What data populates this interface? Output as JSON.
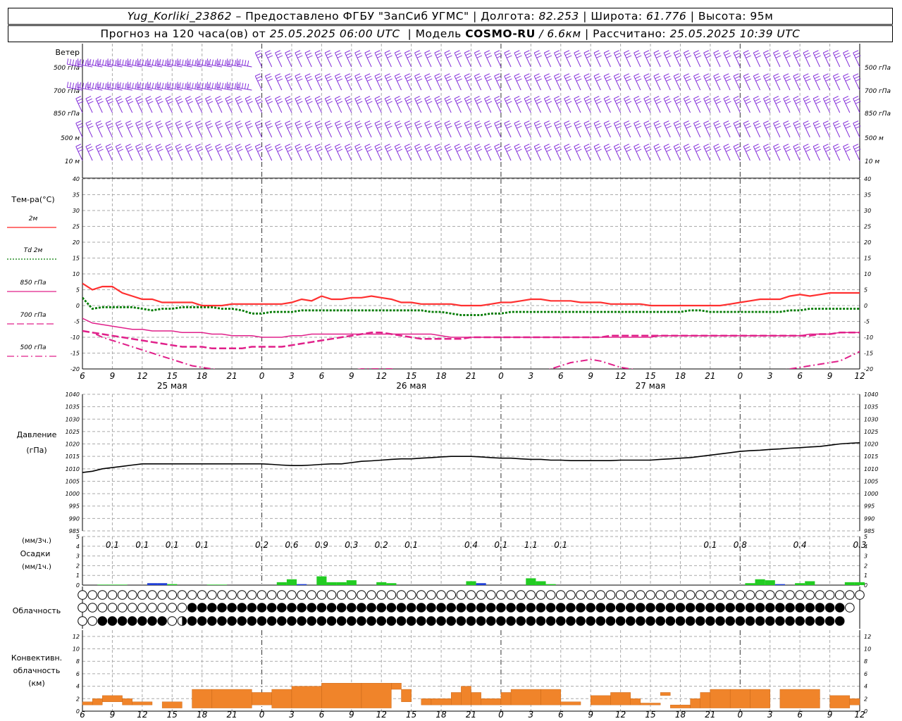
{
  "header": {
    "line1": {
      "station": "Yug_Korliki_23862",
      "provider": " – Предоставлено ФГБУ \"ЗапСиб УГМС\" | Долгота: ",
      "lon": "82.253",
      "lat_label": " | Широта: ",
      "lat": "61.776",
      "alt_label": " | Высота: 95м"
    },
    "line2": {
      "forecast": "Прогноз на 120 часа(ов) от ",
      "start": "25.05.2025 06:00 UTC",
      "model_label": "  | Модель ",
      "model": "COSMO-RU",
      "res": " / 6.6км",
      "calc_label": " | Рассчитано: ",
      "calc": "25.05.2025 10:39 UTC"
    }
  },
  "x_ticks": [
    "6",
    "9",
    "12",
    "15",
    "18",
    "21",
    "0",
    "3",
    "6",
    "9",
    "12",
    "15",
    "18",
    "21",
    "0",
    "3",
    "6",
    "9",
    "12",
    "15",
    "18",
    "21",
    "0",
    "3",
    "6",
    "9",
    "12"
  ],
  "day_labels": [
    {
      "hour": 9,
      "text": "25 мая"
    },
    {
      "hour": 33,
      "text": "26 мая"
    },
    {
      "hour": 57,
      "text": "27 мая"
    }
  ],
  "day_boundaries": [
    18,
    42,
    66
  ],
  "wind_panel": {
    "title": "Ветер",
    "levels": [
      "500 гПа",
      "700 гПа",
      "850 гПа",
      "500 м",
      "10  м"
    ],
    "color": "#7a1fd6"
  },
  "temp_panel": {
    "title": "Тем-ра(°C)",
    "legend": [
      {
        "label": "2м",
        "color": "#ff2020",
        "style": "solid"
      },
      {
        "label": "Td  2м",
        "color": "#007a00",
        "style": "dotted"
      },
      {
        "label": "850 гПа",
        "color": "#e0208a",
        "style": "solid"
      },
      {
        "label": "700 гПа",
        "color": "#e0208a",
        "style": "dash"
      },
      {
        "label": "500 гПа",
        "color": "#e0208a",
        "style": "dashdot"
      }
    ],
    "y_ticks": [
      "40",
      "35",
      "30",
      "25",
      "20",
      "15",
      "10",
      "5",
      "0",
      "-5",
      "-10",
      "-15",
      "-20"
    ]
  },
  "pressure_panel": {
    "title": "Давление",
    "unit": "(гПа)",
    "y_ticks": [
      "1040",
      "1035",
      "1030",
      "1025",
      "1020",
      "1015",
      "1010",
      "1005",
      "1000",
      "995",
      "990",
      "985"
    ]
  },
  "precip_panel": {
    "title": "Осадки",
    "unit3h": "(мм/3ч.)",
    "unit1h": "(мм/1ч.)",
    "y_ticks": [
      "5",
      "4",
      "3",
      "2",
      "1",
      "0"
    ],
    "labels": [
      {
        "hour": 3,
        "text": "0.1"
      },
      {
        "hour": 6,
        "text": "0.1"
      },
      {
        "hour": 9,
        "text": "0.1"
      },
      {
        "hour": 12,
        "text": "0.1"
      },
      {
        "hour": 18,
        "text": "0.2"
      },
      {
        "hour": 21,
        "text": "0.6"
      },
      {
        "hour": 24,
        "text": "0.9"
      },
      {
        "hour": 27,
        "text": "0.3"
      },
      {
        "hour": 30,
        "text": "0.2"
      },
      {
        "hour": 33,
        "text": "0.1"
      },
      {
        "hour": 39,
        "text": "0.4"
      },
      {
        "hour": 42,
        "text": "0.1"
      },
      {
        "hour": 45,
        "text": "1.1"
      },
      {
        "hour": 48,
        "text": "0.1"
      },
      {
        "hour": 63,
        "text": "0.1"
      },
      {
        "hour": 66,
        "text": "0.8"
      },
      {
        "hour": 72,
        "text": "0.4"
      },
      {
        "hour": 78,
        "text": "0.3"
      }
    ]
  },
  "cloud_panel": {
    "title": "Облачность"
  },
  "conv_panel": {
    "title_lines": [
      "Конвективн.",
      "облачность",
      "(км)"
    ],
    "y_ticks": [
      "12",
      "10",
      "8",
      "6",
      "4",
      "2",
      "0"
    ],
    "color": "#f0842a"
  },
  "chart_data": {
    "type": "line",
    "x_hours_from_start": [
      0,
      1,
      2,
      3,
      4,
      5,
      6,
      7,
      8,
      9,
      10,
      11,
      12,
      13,
      14,
      15,
      16,
      17,
      18,
      19,
      20,
      21,
      22,
      23,
      24,
      25,
      26,
      27,
      28,
      29,
      30,
      31,
      32,
      33,
      34,
      35,
      36,
      37,
      38,
      39,
      40,
      41,
      42,
      43,
      44,
      45,
      46,
      47,
      48,
      49,
      50,
      51,
      52,
      53,
      54,
      55,
      56,
      57,
      58,
      59,
      60,
      61,
      62,
      63,
      64,
      65,
      66,
      67,
      68,
      69,
      70,
      71,
      72,
      73,
      74,
      75,
      76,
      77,
      78
    ],
    "temp_2m": [
      7,
      5,
      6,
      6,
      4,
      3,
      2,
      2,
      1,
      1,
      1,
      1,
      0,
      0,
      0,
      0.5,
      0.5,
      0.5,
      0.5,
      0.5,
      0.5,
      1,
      2,
      1.5,
      3,
      2,
      2,
      2.5,
      2.5,
      3,
      2.5,
      2,
      1,
      1,
      0.5,
      0.5,
      0.5,
      0.5,
      0,
      0,
      0,
      0.5,
      1,
      1,
      1.5,
      2,
      2,
      1.5,
      1.5,
      1.5,
      1,
      1,
      1,
      0.5,
      0.5,
      0.5,
      0.5,
      0,
      0,
      0,
      0,
      0,
      0,
      0,
      0,
      0.5,
      1,
      1.5,
      2,
      2,
      2,
      3,
      3.5,
      3,
      3.5,
      4,
      4,
      4,
      4
    ],
    "td_2m": [
      2.5,
      -1,
      -0.5,
      -0.5,
      -0.5,
      -0.5,
      -1,
      -1.5,
      -1,
      -1,
      -0.5,
      -0.5,
      -0.5,
      -0.5,
      -1,
      -1,
      -1.5,
      -2.5,
      -2.5,
      -2,
      -2,
      -2,
      -1.5,
      -1.5,
      -1.5,
      -1.5,
      -1.5,
      -1.5,
      -1.5,
      -1.5,
      -1.5,
      -1.5,
      -1.5,
      -1.5,
      -1.5,
      -2,
      -2,
      -2.5,
      -3,
      -3,
      -3,
      -2.5,
      -2.5,
      -2,
      -2,
      -2,
      -2,
      -2,
      -2,
      -2,
      -2,
      -2,
      -2,
      -2,
      -2,
      -2,
      -2,
      -2,
      -2,
      -2,
      -2,
      -1.5,
      -1.5,
      -2,
      -2,
      -2,
      -2,
      -2,
      -2,
      -2,
      -2,
      -1.5,
      -1.5,
      -1,
      -1,
      -1,
      -1,
      -1,
      -1
    ],
    "t850": [
      -4,
      -5.5,
      -6,
      -6.5,
      -7,
      -7.5,
      -7.5,
      -8,
      -8,
      -8,
      -8.5,
      -8.5,
      -8.5,
      -9,
      -9,
      -9.5,
      -9.5,
      -9.5,
      -10,
      -10,
      -10,
      -9.5,
      -9.5,
      -9,
      -9,
      -9,
      -9,
      -9,
      -9,
      -9,
      -9,
      -9,
      -9,
      -9,
      -9,
      -9,
      -9.5,
      -10,
      -10,
      -10,
      -10,
      -10,
      -10,
      -10,
      -10,
      -10,
      -10,
      -10,
      -10,
      -10,
      -10,
      -10,
      -10,
      -10,
      -10,
      -10,
      -10,
      -10,
      -9.5,
      -9.5,
      -9.5,
      -9.5,
      -9.5,
      -9.5,
      -9.5,
      -9.5,
      -9.5,
      -9.5,
      -9.5,
      -9.5,
      -9.5,
      -9.5,
      -9.5,
      -9,
      -9,
      -9,
      -8.5,
      -8.5,
      -8.5
    ],
    "t700": [
      -8,
      -8.5,
      -9,
      -9.5,
      -10,
      -10.5,
      -11,
      -11.5,
      -12,
      -12.5,
      -13,
      -13,
      -13,
      -13.5,
      -13.5,
      -13.5,
      -13.5,
      -13,
      -13,
      -13,
      -13,
      -12.5,
      -12,
      -11.5,
      -11,
      -10.5,
      -10,
      -9.5,
      -9,
      -8.5,
      -8.5,
      -9,
      -9.5,
      -10,
      -10.5,
      -10.5,
      -10.5,
      -10.5,
      -10.5,
      -10,
      -10,
      -10,
      -10,
      -10,
      -10,
      -10,
      -10,
      -10,
      -10,
      -10,
      -10,
      -10,
      -10,
      -9.5,
      -9.5,
      -9.5,
      -9.5,
      -9.5,
      -9.5,
      -9.5,
      -9.5,
      -9.5,
      -9.5,
      -9.5,
      -9.5,
      -9.5,
      -9.5,
      -9.5,
      -9.5,
      -9.5,
      -9.5,
      -9.5,
      -9.5,
      -9.5,
      -9,
      -9,
      -8.5,
      -8.5,
      -8.5
    ],
    "t500": [
      -8,
      -8.5,
      -10,
      -11,
      -12,
      -13,
      -14,
      -15,
      -16,
      -17,
      -18,
      -19,
      -19.5,
      -20,
      -20.5,
      -21,
      -21.5,
      -22,
      -22,
      -22,
      -22,
      -22,
      -22,
      -21.5,
      -21,
      -21,
      -21,
      -20.5,
      -20,
      -20,
      -20,
      -20,
      -20.5,
      -21,
      -21.5,
      -22,
      -22,
      -22,
      -22,
      -22,
      -22,
      -22,
      -22,
      -22,
      -22,
      -21.5,
      -21,
      -20,
      -19,
      -18,
      -17.5,
      -17,
      -17.5,
      -18.5,
      -19.5,
      -20,
      -20.5,
      -21,
      -21.5,
      -22,
      -22,
      -22,
      -22,
      -22,
      -22,
      -22,
      -22,
      -22,
      -21.5,
      -21,
      -20.5,
      -20,
      -19.5,
      -19,
      -18.5,
      -18,
      -17.5,
      -16,
      -14.5
    ],
    "pressure": [
      1008.5,
      1009,
      1010,
      1010.5,
      1011,
      1011.5,
      1012,
      1012,
      1012,
      1012,
      1012,
      1012,
      1012,
      1012,
      1012,
      1012,
      1012,
      1012,
      1012,
      1011.8,
      1011.5,
      1011.3,
      1011.3,
      1011.5,
      1011.8,
      1012,
      1012,
      1012.5,
      1013,
      1013.2,
      1013.5,
      1013.8,
      1014,
      1014,
      1014.3,
      1014.5,
      1014.8,
      1015,
      1015,
      1015,
      1014.8,
      1014.5,
      1014.3,
      1014.3,
      1014,
      1013.8,
      1013.8,
      1013.5,
      1013.5,
      1013.3,
      1013.3,
      1013.3,
      1013.3,
      1013.3,
      1013.5,
      1013.5,
      1013.5,
      1013.5,
      1013.8,
      1014,
      1014.3,
      1014.5,
      1015,
      1015.5,
      1016,
      1016.5,
      1017,
      1017.3,
      1017.5,
      1017.8,
      1018,
      1018.3,
      1018.5,
      1018.8,
      1019,
      1019.5,
      1020,
      1020.3,
      1020.5
    ],
    "precip_1h": [
      0,
      0,
      0,
      0,
      0.1,
      0,
      0,
      0,
      0,
      0,
      0,
      0,
      0,
      0,
      0,
      0,
      0,
      0,
      0,
      0,
      0,
      0,
      0,
      0,
      0,
      0,
      0,
      0,
      0,
      0,
      0,
      0,
      0,
      0,
      0,
      0,
      0,
      0,
      0,
      0,
      0,
      0,
      0,
      0,
      0,
      0,
      0,
      0,
      0,
      0,
      0,
      0,
      0,
      0,
      0,
      0,
      0,
      0,
      0,
      0,
      0,
      0,
      0,
      0,
      0,
      0,
      0,
      0,
      0,
      0,
      0,
      0,
      0,
      0,
      0,
      0,
      0,
      0,
      0
    ],
    "precip_bars": [
      {
        "hour": 2,
        "value": 0.05,
        "type": "rain"
      },
      {
        "hour": 3,
        "value": 0.05,
        "type": "rain"
      },
      {
        "hour": 4,
        "value": 0.05,
        "type": "rain"
      },
      {
        "hour": 7,
        "value": 0.2,
        "type": "snow"
      },
      {
        "hour": 8,
        "value": 0.2,
        "type": "snow"
      },
      {
        "hour": 9,
        "value": 0.1,
        "type": "rain"
      },
      {
        "hour": 13,
        "value": 0.05,
        "type": "rain"
      },
      {
        "hour": 14,
        "value": 0.05,
        "type": "rain"
      },
      {
        "hour": 20,
        "value": 0.3,
        "type": "rain"
      },
      {
        "hour": 21,
        "value": 0.6,
        "type": "rain"
      },
      {
        "hour": 22,
        "value": 0.1,
        "type": "snow"
      },
      {
        "hour": 24,
        "value": 0.9,
        "type": "rain"
      },
      {
        "hour": 25,
        "value": 0.3,
        "type": "rain"
      },
      {
        "hour": 26,
        "value": 0.3,
        "type": "rain"
      },
      {
        "hour": 27,
        "value": 0.5,
        "type": "rain"
      },
      {
        "hour": 30,
        "value": 0.3,
        "type": "rain"
      },
      {
        "hour": 31,
        "value": 0.2,
        "type": "rain"
      },
      {
        "hour": 39,
        "value": 0.4,
        "type": "rain"
      },
      {
        "hour": 40,
        "value": 0.2,
        "type": "snow"
      },
      {
        "hour": 45,
        "value": 0.7,
        "type": "rain"
      },
      {
        "hour": 46,
        "value": 0.4,
        "type": "rain"
      },
      {
        "hour": 47,
        "value": 0.1,
        "type": "rain"
      },
      {
        "hour": 67,
        "value": 0.2,
        "type": "rain"
      },
      {
        "hour": 68,
        "value": 0.6,
        "type": "rain"
      },
      {
        "hour": 69,
        "value": 0.5,
        "type": "rain"
      },
      {
        "hour": 70,
        "value": 0.1,
        "type": "snow"
      },
      {
        "hour": 72,
        "value": 0.2,
        "type": "rain"
      },
      {
        "hour": 73,
        "value": 0.4,
        "type": "rain"
      },
      {
        "hour": 77,
        "value": 0.3,
        "type": "rain"
      },
      {
        "hour": 78,
        "value": 0.3,
        "type": "rain"
      }
    ],
    "conv_cloud_km": [
      {
        "from": 0,
        "to": 1,
        "base": 1,
        "top": 1.5
      },
      {
        "from": 1,
        "to": 2,
        "base": 1,
        "top": 2
      },
      {
        "from": 2,
        "to": 4,
        "base": 1.5,
        "top": 2.5
      },
      {
        "from": 4,
        "to": 5,
        "base": 1,
        "top": 2
      },
      {
        "from": 5,
        "to": 7,
        "base": 1,
        "top": 1.5
      },
      {
        "from": 8,
        "to": 10,
        "base": 0.5,
        "top": 1.5
      },
      {
        "from": 11,
        "to": 13,
        "base": 0.5,
        "top": 3.5
      },
      {
        "from": 13,
        "to": 17,
        "base": 0.5,
        "top": 3.5
      },
      {
        "from": 17,
        "to": 19,
        "base": 1,
        "top": 3
      },
      {
        "from": 19,
        "to": 21,
        "base": 0.5,
        "top": 3.5
      },
      {
        "from": 21,
        "to": 24,
        "base": 0.5,
        "top": 4
      },
      {
        "from": 24,
        "to": 28,
        "base": 0.5,
        "top": 4.5
      },
      {
        "from": 28,
        "to": 31,
        "base": 0.5,
        "top": 4.5
      },
      {
        "from": 31,
        "to": 32,
        "base": 3.5,
        "top": 4.5
      },
      {
        "from": 32,
        "to": 33,
        "base": 1.5,
        "top": 3.5
      },
      {
        "from": 34,
        "to": 35,
        "base": 1,
        "top": 2
      },
      {
        "from": 35,
        "to": 37,
        "base": 1,
        "top": 2
      },
      {
        "from": 37,
        "to": 38,
        "base": 1,
        "top": 3
      },
      {
        "from": 38,
        "to": 39,
        "base": 1,
        "top": 4
      },
      {
        "from": 39,
        "to": 40,
        "base": 1,
        "top": 3
      },
      {
        "from": 40,
        "to": 42,
        "base": 1,
        "top": 2
      },
      {
        "from": 42,
        "to": 43,
        "base": 1,
        "top": 3
      },
      {
        "from": 43,
        "to": 46,
        "base": 1,
        "top": 3.5
      },
      {
        "from": 46,
        "to": 48,
        "base": 1,
        "top": 3.5
      },
      {
        "from": 48,
        "to": 50,
        "base": 1,
        "top": 1.5
      },
      {
        "from": 51,
        "to": 53,
        "base": 1,
        "top": 2.5
      },
      {
        "from": 53,
        "to": 55,
        "base": 1,
        "top": 3
      },
      {
        "from": 55,
        "to": 56,
        "base": 1,
        "top": 2
      },
      {
        "from": 56,
        "to": 58,
        "base": 1,
        "top": 1.3
      },
      {
        "from": 58,
        "to": 59,
        "base": 2.5,
        "top": 3
      },
      {
        "from": 59,
        "to": 61,
        "base": 0.5,
        "top": 1
      },
      {
        "from": 61,
        "to": 62,
        "base": 0.5,
        "top": 2
      },
      {
        "from": 62,
        "to": 63,
        "base": 0.5,
        "top": 3
      },
      {
        "from": 63,
        "to": 65,
        "base": 0.5,
        "top": 3.5
      },
      {
        "from": 65,
        "to": 67,
        "base": 0.5,
        "top": 3.5
      },
      {
        "from": 67,
        "to": 69,
        "base": 0.5,
        "top": 3.5
      },
      {
        "from": 70,
        "to": 74,
        "base": 0.5,
        "top": 3.5
      },
      {
        "from": 75,
        "to": 77,
        "base": 0.5,
        "top": 2.5
      },
      {
        "from": 77,
        "to": 78,
        "base": 1,
        "top": 2
      }
    ],
    "cloud_rows": [
      "OOOOOOOOOOOOOOOOOOOOOOOOOOOOOOOOOOOOOOOOOOOOOOOOOOOOOOOOOOOOOOOOOOOOOOOOOOOOOOO",
      "OOOOOOOOOOOHHHHHHHHHHHHHHHHHHHHHHHHHHHHHHHHHHHHHHHHHHHHHHHHHHHHHHHHHHHHHHHHHHO",
      "OOHHHHHHHOQHHHHHHHHHHHHHHHHHHHHHHHHHHHHHHHHHHHHHHHHHHHHHHHHHHHHHHHHHHHHHHHHHH"
    ],
    "ylim_temp": [
      -20,
      40
    ],
    "ylim_pressure": [
      985,
      1040
    ],
    "ylim_precip": [
      0,
      5
    ],
    "ylim_conv": [
      0,
      13
    ]
  }
}
